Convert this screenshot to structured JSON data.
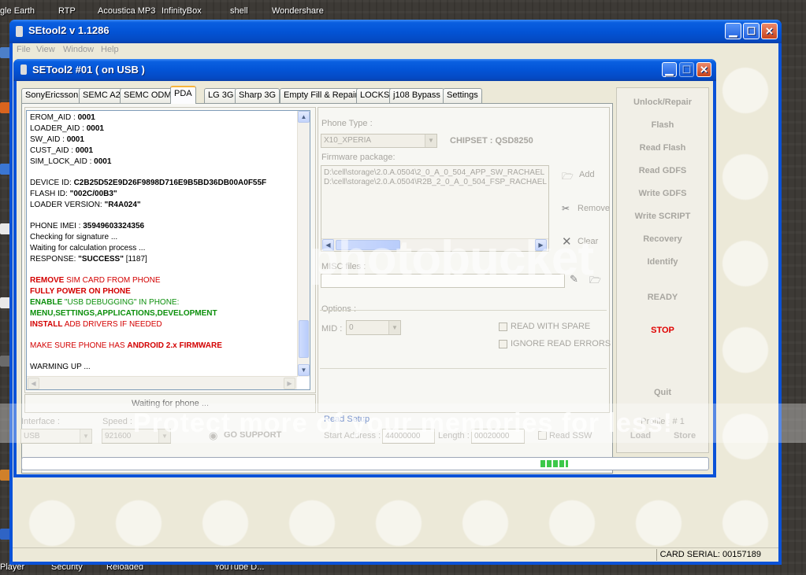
{
  "desktop": {
    "top_icons": [
      "gle Earth",
      "RTP",
      "Acoustica MP3",
      "InfinityBox",
      "shell",
      "Wondershare"
    ],
    "bottom_icons": [
      "Player",
      "Security",
      "Reloaded",
      "YouTube D..."
    ]
  },
  "outer_window": {
    "title": "SEtool2 v 1.1286",
    "menu": [
      "File",
      "View",
      "Window",
      "Help"
    ],
    "status": {
      "card_serial": "CARD SERIAL: 00157189"
    }
  },
  "inner_window": {
    "title": "SETool2 #01  ( on USB )",
    "tabs": [
      "SonyEricsson",
      "SEMC A2",
      "SEMC ODM",
      "PDA",
      "LG 3G",
      "Sharp 3G",
      "Empty Fill & Repair",
      "LOCKS",
      "j108 Bypass",
      "Settings"
    ],
    "active_tab": "PDA",
    "log": [
      {
        "label": "EROM_AID : ",
        "value": "0001"
      },
      {
        "label": "LOADER_AID : ",
        "value": "0001"
      },
      {
        "label": "SW_AID : ",
        "value": "0001"
      },
      {
        "label": "CUST_AID : ",
        "value": "0001"
      },
      {
        "label": "SIM_LOCK_AID : ",
        "value": "0001"
      },
      {
        "label": "DEVICE ID: ",
        "value": "C2B25D52E9D26F9898D716E9B5BD36DB00A0F55F"
      },
      {
        "label": "FLASH ID: ",
        "value": "\"002C/00B3\""
      },
      {
        "label": "LOADER VERSION: ",
        "value": "\"R4A024\""
      },
      {
        "label": "PHONE IMEI : ",
        "value": "35949603324356"
      },
      {
        "label": "Checking for signature ...",
        "value": ""
      },
      {
        "label": "Waiting for calculation process ...",
        "value": ""
      },
      {
        "label": "RESPONSE: ",
        "value": "\"SUCCESS\"",
        "suffix": " [1187]"
      },
      {
        "label": "REMOVE",
        "value": " SIM CARD FROM PHONE"
      },
      {
        "label": "FULLY POWER ON PHONE",
        "value": ""
      },
      {
        "label": "ENABLE",
        "value": " \"USB DEBUGGING\" IN PHONE:"
      },
      {
        "label": "MENU,SETTINGS,APPLICATIONS,DEVELOPMENT",
        "value": ""
      },
      {
        "label": "INSTALL",
        "value": " ADB DRIVERS IF NEEDED"
      },
      {
        "label": "MAKE SURE PHONE HAS ",
        "value": "ANDROID 2.x FIRMWARE"
      },
      {
        "label": "WARMING UP ...",
        "value": ""
      }
    ],
    "waiting_label": "Waiting for phone ...",
    "phone_type_label": "Phone Type :",
    "phone_type_value": "X10_XPERIA",
    "chipset_label": "CHIPSET : QSD8250",
    "firmware_label": "Firmware package:",
    "firmware_files": [
      "D:\\cell\\storage\\2.0.A.0504\\2_0_A_0_504_APP_SW_RACHAEL",
      "D:\\cell\\storage\\2.0.A.0504\\R2B_2_0_A_0_504_FSP_RACHAEL"
    ],
    "add_label": "Add",
    "remove_label": "Remove",
    "clear_label": "Clear",
    "misc_label": "MISC files :",
    "options_label": "Options :",
    "mid_label": "MID :",
    "mid_value": "0",
    "read_with_spare": "READ WITH SPARE",
    "ignore_read_errors": "IGNORE READ ERRORS",
    "right_buttons": [
      "Unlock/Repair",
      "Flash",
      "Read Flash",
      "Read GDFS",
      "Write GDFS",
      "Write SCRIPT",
      "Recovery",
      "Identify"
    ],
    "ready_label": "READY",
    "stop_label": "STOP",
    "quit_label": "Quit",
    "profile_label": "Profile : # 1",
    "load_label": "Load",
    "store_label": "Store",
    "interface_label": "Interface :",
    "interface_value": "USB",
    "speed_label": "Speed :",
    "speed_value": "921600",
    "go_support": "GO SUPPORT",
    "read_setup": "Read Setup",
    "start_address_label": "Start Address :",
    "start_address_value": "44000000",
    "length_label": "Length :",
    "length_value": "00020000",
    "read_ssw": "Read SSW",
    "progress_fraction": 0.04
  },
  "watermark": {
    "logo": "photobucket",
    "tagline": "Protect more of your memories for less!"
  },
  "colors": {
    "xp_blue": "#0354d6",
    "face": "#ece9d8",
    "log_red": "#d30000",
    "log_green": "#0b8f0b",
    "stop_red": "#e00000",
    "progress_green": "#3cc84a"
  }
}
